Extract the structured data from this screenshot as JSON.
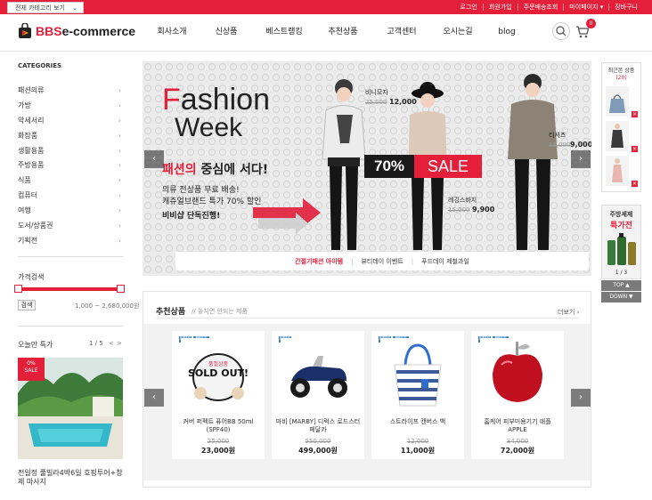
{
  "topbar": {
    "category_button": "전체 카테고리 보기",
    "links": [
      "로그인",
      "회원가입",
      "주문배송조회",
      "마이페이지",
      "장바구니"
    ]
  },
  "header": {
    "logo_brand": "BBS",
    "logo_rest": "e-commerce",
    "nav": [
      "회사소개",
      "신상품",
      "베스트랭킹",
      "추천상품",
      "고객센터",
      "오시는길",
      "blog"
    ],
    "cart_count": "0"
  },
  "sidebar": {
    "categories_title": "CATEGORIES",
    "categories": [
      "패션의류",
      "가방",
      "악세서리",
      "화장품",
      "생활용품",
      "주방용품",
      "식품",
      "컴퓨터",
      "여행",
      "도서/상품권",
      "기획전"
    ],
    "price_title": "가격검색",
    "search_button": "검색",
    "price_range": "1,000 ~ 2,680,000원",
    "today_title": "오늘만 특가",
    "today_pager": "1 / 5",
    "today_prev": "<",
    "today_next": ">",
    "today_badge_pct": "0%",
    "today_badge_label": "SALE",
    "today_name": "전일정 풀빌라4박6일 호핑투어+창제 마사지"
  },
  "banner": {
    "title_f": "F",
    "title_ashion": "ashion",
    "title_week": "Week",
    "headline_red": "패션의",
    "headline_rest": " 중심에 서다!",
    "line1": "의류 전상품 무료 배송!",
    "line2": "캐쥬얼브랜드 특가 70% 할인",
    "line3": "비비샵 단독진행!",
    "sale_pct": "70%",
    "sale_word": "SALE",
    "items": [
      {
        "name": "비니모자",
        "old": "25,000",
        "price": "12,000"
      },
      {
        "name": "티셔츠",
        "old": "13,000",
        "price": "9,000"
      },
      {
        "name": "레깅스바지",
        "old": "15,000",
        "price": "9,900"
      }
    ],
    "tabs": [
      "간절기패션 아이템",
      "뷰티데이 이벤트",
      "푸드데이 제철과일"
    ],
    "tab_separator": "|"
  },
  "right": {
    "recent_title": "최근본 상품",
    "recent_count": "(20)",
    "remove_glyph": "×",
    "promo_line1": "주방세제",
    "promo_line2": "특가전",
    "promo_pager": "1 / 3",
    "top_label": "TOP ▲",
    "down_label": "DOWN ▼"
  },
  "products": {
    "title": "추천상품",
    "subtitle": "// 놓치면 안되는 제품",
    "more": "더보기",
    "items": [
      {
        "name": "커버 퍼펙트 퓨어BB 50ml (SPF40)",
        "old": "25,000",
        "price": "23,000원",
        "badges": [
          "NEW",
          "BEST"
        ],
        "soldout_label": "품절상품",
        "soldout_text": "SOLD OUT!"
      },
      {
        "name": "마비 [MARBY] 디럭스 로드스터 페달카",
        "old": "550,000",
        "price": "499,000원",
        "badges": [
          "NEW"
        ]
      },
      {
        "name": "스트라이프 캔버스 백",
        "old": "12,000",
        "price": "11,000원",
        "badges": [
          "NEW",
          "BEST"
        ]
      },
      {
        "name": "홈케어 피부미용기기 애플 APPLE",
        "old": "34,000",
        "price": "72,000원",
        "badges": [
          "NEW",
          "BEST"
        ]
      }
    ]
  },
  "colors": {
    "accent": "#e31f3a",
    "badge": "#3f85c9"
  },
  "icons": [
    "search-icon",
    "cart-icon",
    "chevron-left-icon",
    "chevron-right-icon"
  ]
}
